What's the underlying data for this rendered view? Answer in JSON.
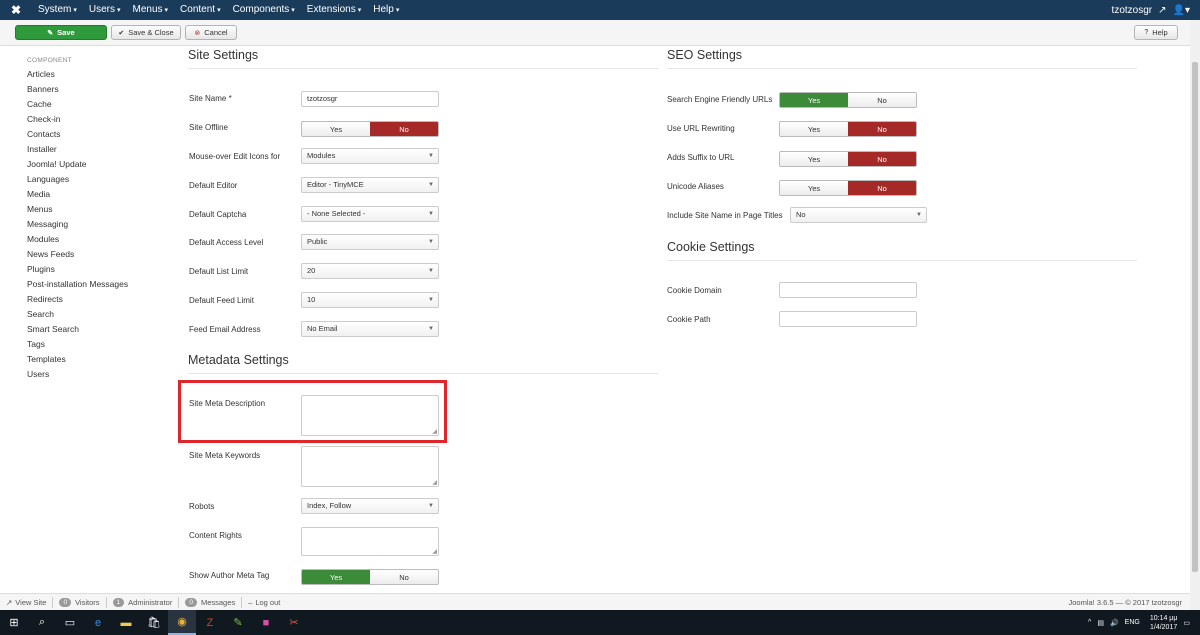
{
  "navbar": {
    "logo": "✖",
    "menus": [
      "System",
      "Users",
      "Menus",
      "Content",
      "Components",
      "Extensions",
      "Help"
    ],
    "user": "tzotzosgr",
    "user_icon": "external-link-icon",
    "account_icon": "user-icon"
  },
  "toolbar": {
    "save_label": "Save",
    "save_close_label": "Save & Close",
    "cancel_label": "Cancel",
    "help_label": "Help"
  },
  "sidebar": {
    "heading": "COMPONENT",
    "items": [
      "Articles",
      "Banners",
      "Cache",
      "Check-in",
      "Contacts",
      "Installer",
      "Joomla! Update",
      "Languages",
      "Media",
      "Menus",
      "Messaging",
      "Modules",
      "News Feeds",
      "Plugins",
      "Post-installation Messages",
      "Redirects",
      "Search",
      "Smart Search",
      "Tags",
      "Templates",
      "Users"
    ]
  },
  "site_settings": {
    "title": "Site Settings",
    "site_name_label": "Site Name *",
    "site_name_value": "tzotzosgr",
    "site_offline_label": "Site Offline",
    "yes": "Yes",
    "no": "No",
    "mouseover_label": "Mouse-over Edit Icons for",
    "mouseover_value": "Modules",
    "editor_label": "Default Editor",
    "editor_value": "Editor - TinyMCE",
    "captcha_label": "Default Captcha",
    "captcha_value": "- None Selected -",
    "access_label": "Default Access Level",
    "access_value": "Public",
    "list_limit_label": "Default List Limit",
    "list_limit_value": "20",
    "feed_limit_label": "Default Feed Limit",
    "feed_limit_value": "10",
    "feed_email_label": "Feed Email Address",
    "feed_email_value": "No Email"
  },
  "metadata_settings": {
    "title": "Metadata Settings",
    "meta_desc_label": "Site Meta Description",
    "meta_keywords_label": "Site Meta Keywords",
    "robots_label": "Robots",
    "robots_value": "Index, Follow",
    "rights_label": "Content Rights",
    "author_meta_label": "Show Author Meta Tag",
    "yes": "Yes",
    "no": "No"
  },
  "seo_settings": {
    "title": "SEO Settings",
    "sef_label": "Search Engine Friendly URLs",
    "rewrite_label": "Use URL Rewriting",
    "suffix_label": "Adds Suffix to URL",
    "unicode_label": "Unicode Aliases",
    "sitename_titles_label": "Include Site Name in Page Titles",
    "sitename_titles_value": "No",
    "yes": "Yes",
    "no": "No"
  },
  "cookie_settings": {
    "title": "Cookie Settings",
    "domain_label": "Cookie Domain",
    "path_label": "Cookie Path"
  },
  "statusbar": {
    "view_site": "View Site",
    "visitors_count": "0",
    "visitors": "Visitors",
    "admin_count": "1",
    "admin": "Administrator",
    "messages_count": "0",
    "messages": "Messages",
    "logout": "Log out",
    "copyright": "Joomla! 3.6.5 — © 2017 tzotzosgr"
  },
  "taskbar": {
    "lang": "ENG",
    "time": "10:14 μμ",
    "date": "1/4/2017"
  },
  "colors": {
    "navbar": "#1b3b5b",
    "save_green": "#2f9a3c",
    "toggle_red": "#a52927",
    "toggle_green": "#3b8b38",
    "highlight_red": "#e0262d"
  }
}
